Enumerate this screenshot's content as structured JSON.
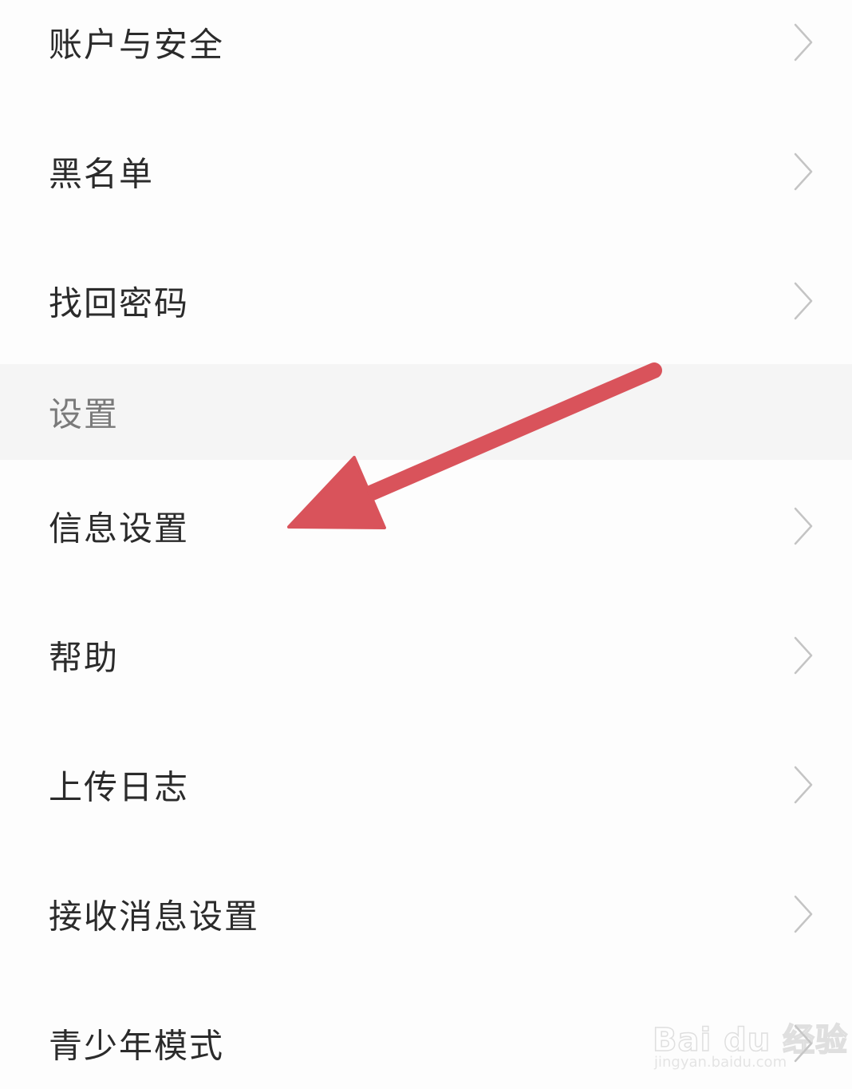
{
  "account_section": {
    "items": [
      {
        "label": "账户与安全",
        "icon": "chevron-right-icon"
      },
      {
        "label": "黑名单",
        "icon": "chevron-right-icon"
      },
      {
        "label": "找回密码",
        "icon": "chevron-right-icon"
      }
    ]
  },
  "settings_section": {
    "header": "设置",
    "items": [
      {
        "label": "信息设置",
        "icon": "chevron-right-icon"
      },
      {
        "label": "帮助",
        "icon": "chevron-right-icon"
      },
      {
        "label": "上传日志",
        "icon": "chevron-right-icon"
      },
      {
        "label": "接收消息设置",
        "icon": "chevron-right-icon"
      },
      {
        "label": "青少年模式",
        "icon": "chevron-right-icon"
      }
    ]
  },
  "annotation": {
    "icon": "red-arrow-icon",
    "color": "#d9535b"
  },
  "watermark": {
    "brand": "Bai du 经验",
    "url": "jingyan.baidu.com"
  },
  "colors": {
    "background": "#fdfdfd",
    "section_header_bg": "#f5f5f5",
    "text": "#2b2b2b",
    "header_text": "#7a7a7a",
    "chevron": "#c4c4c4"
  }
}
